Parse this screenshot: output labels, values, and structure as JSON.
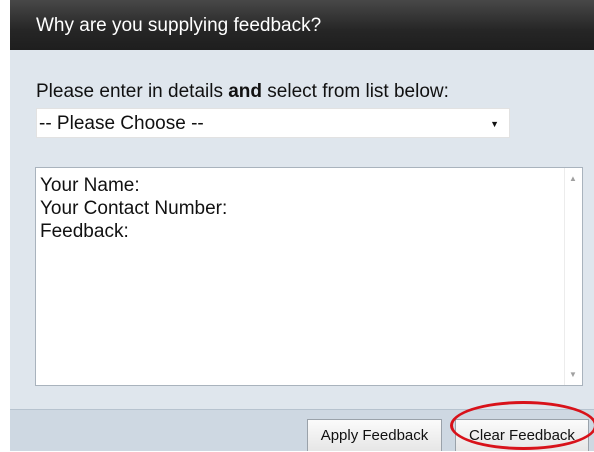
{
  "header": {
    "title": "Why are you supplying feedback?"
  },
  "form": {
    "instruction_prefix": "Please enter in details ",
    "instruction_bold": "and",
    "instruction_suffix": " select from list below:",
    "select": {
      "value": "-- Please Choose --"
    },
    "textarea": {
      "lines": [
        "Your Name:",
        "Your Contact Number:",
        "Feedback:"
      ]
    }
  },
  "buttons": {
    "apply_label": "Apply Feedback",
    "clear_label": "Clear Feedback"
  },
  "colors": {
    "header_bg": "#262626",
    "panel_bg": "#dfe6ed",
    "annotation": "#d8121a"
  }
}
